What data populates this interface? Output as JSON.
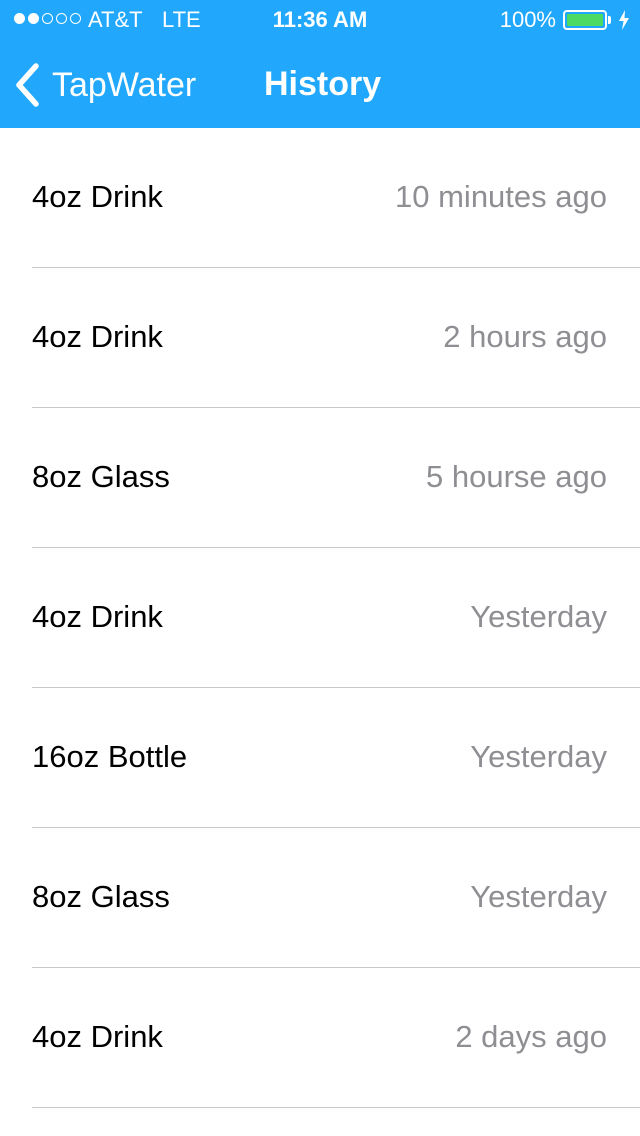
{
  "status_bar": {
    "signal_bars_filled": 2,
    "signal_bars_total": 5,
    "carrier": "AT&T",
    "network": "LTE",
    "time": "11:36 AM",
    "battery_percent": "100%",
    "battery_level": 1.0,
    "battery_color": "#4cd964",
    "charging_icon": "bolt-icon"
  },
  "nav": {
    "back_icon": "chevron-left-icon",
    "back_label": "TapWater",
    "title": "History",
    "bar_color": "#21a8fc"
  },
  "history": [
    {
      "title": "4oz Drink",
      "time": "10 minutes ago"
    },
    {
      "title": "4oz Drink",
      "time": "2 hours ago"
    },
    {
      "title": "8oz Glass",
      "time": "5 hourse ago"
    },
    {
      "title": "4oz Drink",
      "time": "Yesterday"
    },
    {
      "title": "16oz Bottle",
      "time": "Yesterday"
    },
    {
      "title": "8oz Glass",
      "time": "Yesterday"
    },
    {
      "title": "4oz Drink",
      "time": "2 days ago"
    }
  ]
}
